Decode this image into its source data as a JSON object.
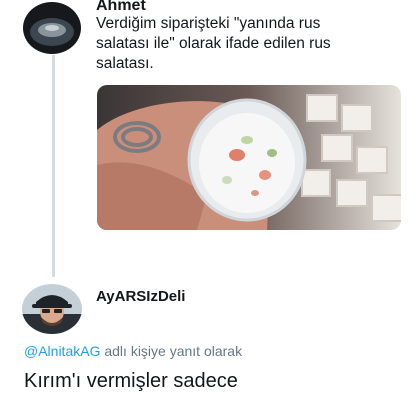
{
  "tweet1": {
    "author": "Ahmet",
    "text_lines": [
      "Verdiğim siparişteki \"yanında rus",
      "salatası ile\" olarak ifade edilen rus",
      "salatası."
    ]
  },
  "tweet2": {
    "author": "AyARSIzDeli",
    "reply_mention": "@AlnitakAG",
    "reply_suffix": "adlı kişiye yanıt olarak",
    "text": "Kırım'ı vermişler sadece"
  }
}
